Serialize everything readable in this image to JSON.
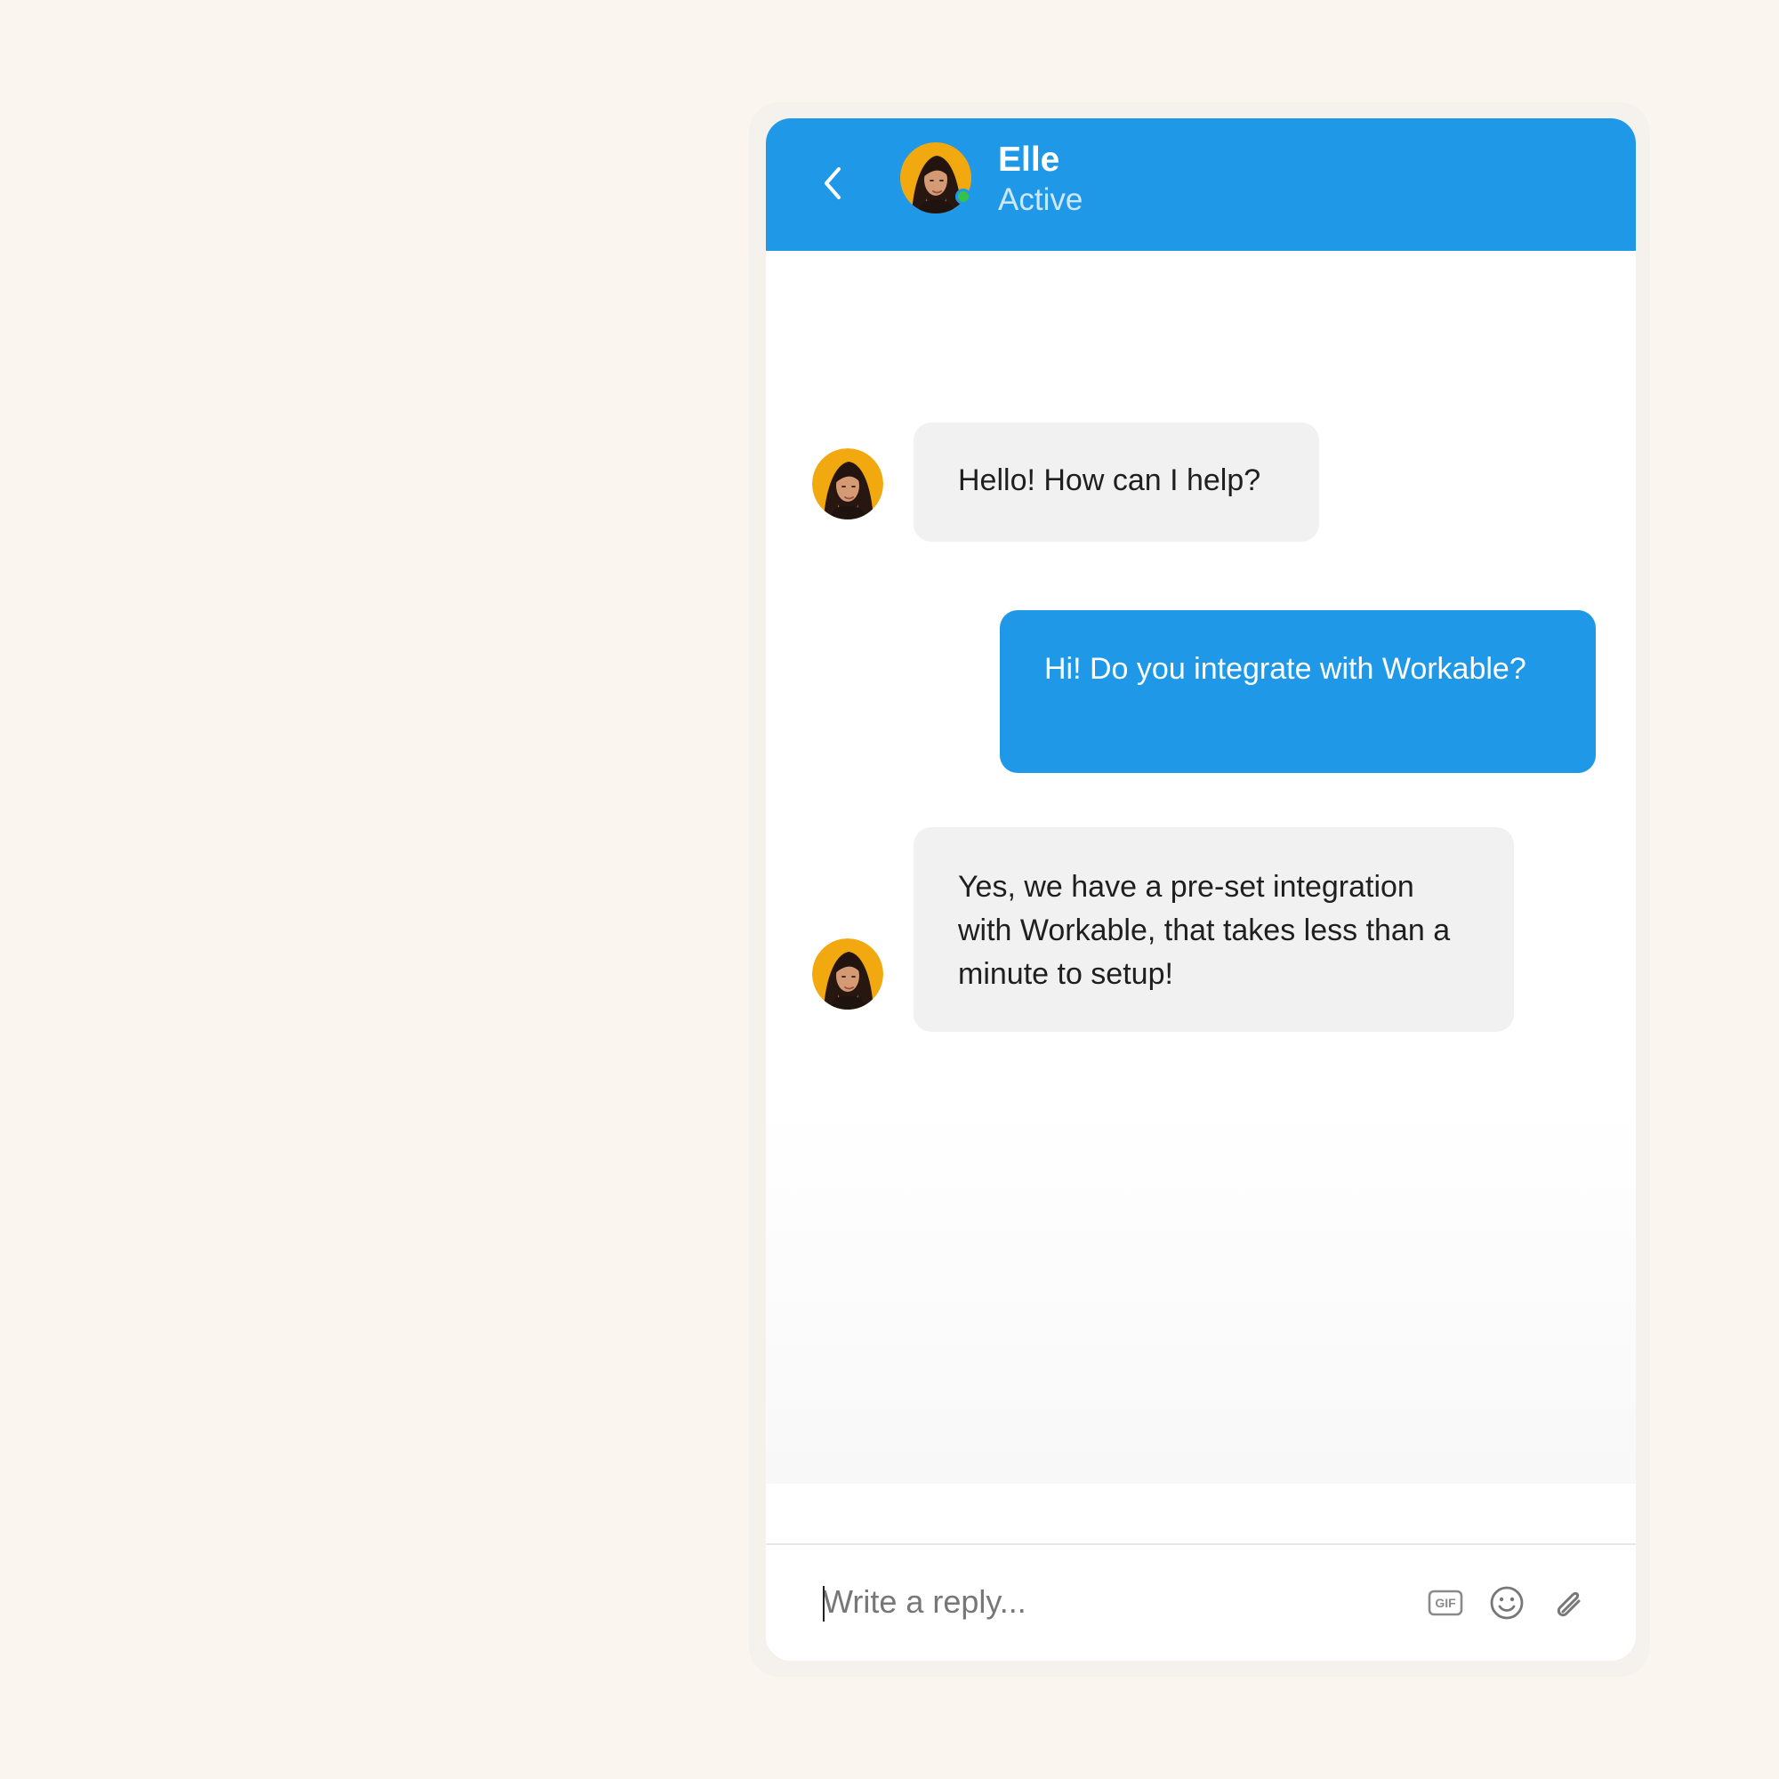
{
  "contact": {
    "name": "Elle",
    "status": "Active"
  },
  "messages": [
    {
      "sender": "agent",
      "text": "Hello! How can I help?"
    },
    {
      "sender": "user",
      "text": "Hi! Do you integrate with Workable?"
    },
    {
      "sender": "agent",
      "text": "Yes, we have a pre-set integration with Workable, that takes less than a minute to setup!"
    }
  ],
  "composer": {
    "placeholder": "Write a reply...",
    "gif_label": "GIF"
  },
  "icons": {
    "back": "chevron-left",
    "gif": "gif",
    "emoji": "smiley-face",
    "attach": "paperclip"
  },
  "colors": {
    "page_background": "#faf5ef",
    "accent_blue": "#1f98e8",
    "online_green": "#35c24b",
    "incoming_bubble": "#f1f1f1"
  }
}
